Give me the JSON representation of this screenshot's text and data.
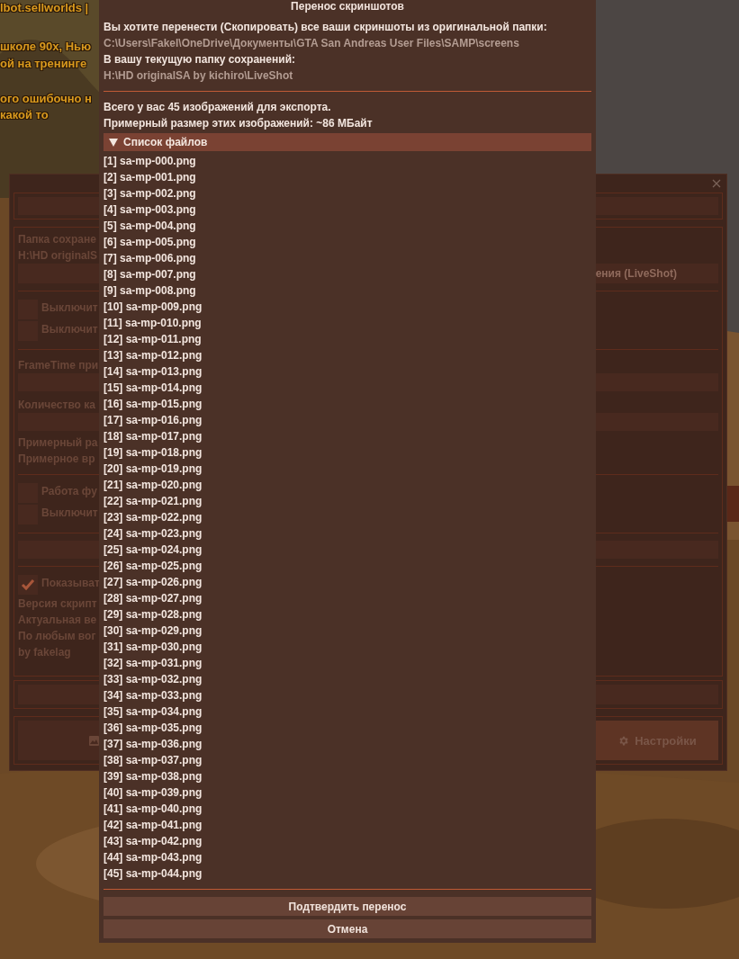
{
  "chat": [
    "lbot.sellworlds |",
    "школе 90х, Нью",
    "ой на тренинге",
    "ого ошибочно н",
    "какой то"
  ],
  "settings_window": {
    "folder_label": "Папка сохране",
    "folder_path": "H:\\HD originalS",
    "folder_button": "ения (LiveShot)",
    "toggles_1": [
      {
        "label": "Выключит",
        "checked": false
      },
      {
        "label": "Выключит",
        "checked": false
      }
    ],
    "frametime_label": "FrameTime при",
    "count_label": "Количество ка",
    "estimates": [
      "Примерный ра",
      "Примерное вр"
    ],
    "toggles_2": [
      {
        "label": "Работа фу",
        "checked": false
      },
      {
        "label": "Выключит",
        "checked": false
      }
    ],
    "toggles_3": [
      {
        "label": "Показыват",
        "checked": true
      }
    ],
    "info": [
      "Версия скрипт",
      "Актуальная ве",
      "По любым вог",
      "by fakelag"
    ],
    "settings_button": "Настройки"
  },
  "dialog": {
    "title": "Перенос скриншотов",
    "intro": "Вы хотите перенести (Скопировать) все ваши скриншоты из оригинальной папки:",
    "source_path": "C:\\Users\\Fakel\\OneDrive\\Документы\\GTA San Andreas User Files\\SAMP\\screens",
    "target_label": "В вашу текущую папку сохранений:",
    "target_path": "H:\\HD originalSA by kichiro\\LiveShot",
    "summary": [
      "Всего у вас 45 изображений для экспорта.",
      "Примерный размер этих изображений: ~86 МБайт"
    ],
    "files_header": {
      "label": "Список файлов",
      "expanded": true
    },
    "files": [
      "[1] sa-mp-000.png",
      "[2] sa-mp-001.png",
      "[3] sa-mp-002.png",
      "[4] sa-mp-003.png",
      "[5] sa-mp-004.png",
      "[6] sa-mp-005.png",
      "[7] sa-mp-006.png",
      "[8] sa-mp-007.png",
      "[9] sa-mp-008.png",
      "[10] sa-mp-009.png",
      "[11] sa-mp-010.png",
      "[12] sa-mp-011.png",
      "[13] sa-mp-012.png",
      "[14] sa-mp-013.png",
      "[15] sa-mp-014.png",
      "[16] sa-mp-015.png",
      "[17] sa-mp-016.png",
      "[18] sa-mp-017.png",
      "[19] sa-mp-018.png",
      "[20] sa-mp-019.png",
      "[21] sa-mp-020.png",
      "[22] sa-mp-021.png",
      "[23] sa-mp-022.png",
      "[24] sa-mp-023.png",
      "[25] sa-mp-024.png",
      "[26] sa-mp-025.png",
      "[27] sa-mp-026.png",
      "[28] sa-mp-027.png",
      "[29] sa-mp-028.png",
      "[30] sa-mp-029.png",
      "[31] sa-mp-030.png",
      "[32] sa-mp-031.png",
      "[33] sa-mp-032.png",
      "[34] sa-mp-033.png",
      "[35] sa-mp-034.png",
      "[36] sa-mp-035.png",
      "[37] sa-mp-036.png",
      "[38] sa-mp-037.png",
      "[39] sa-mp-038.png",
      "[40] sa-mp-039.png",
      "[41] sa-mp-040.png",
      "[42] sa-mp-041.png",
      "[43] sa-mp-042.png",
      "[44] sa-mp-043.png",
      "[45] sa-mp-044.png"
    ],
    "buttons": [
      "Подтвердить перенос",
      "Отмена"
    ]
  }
}
